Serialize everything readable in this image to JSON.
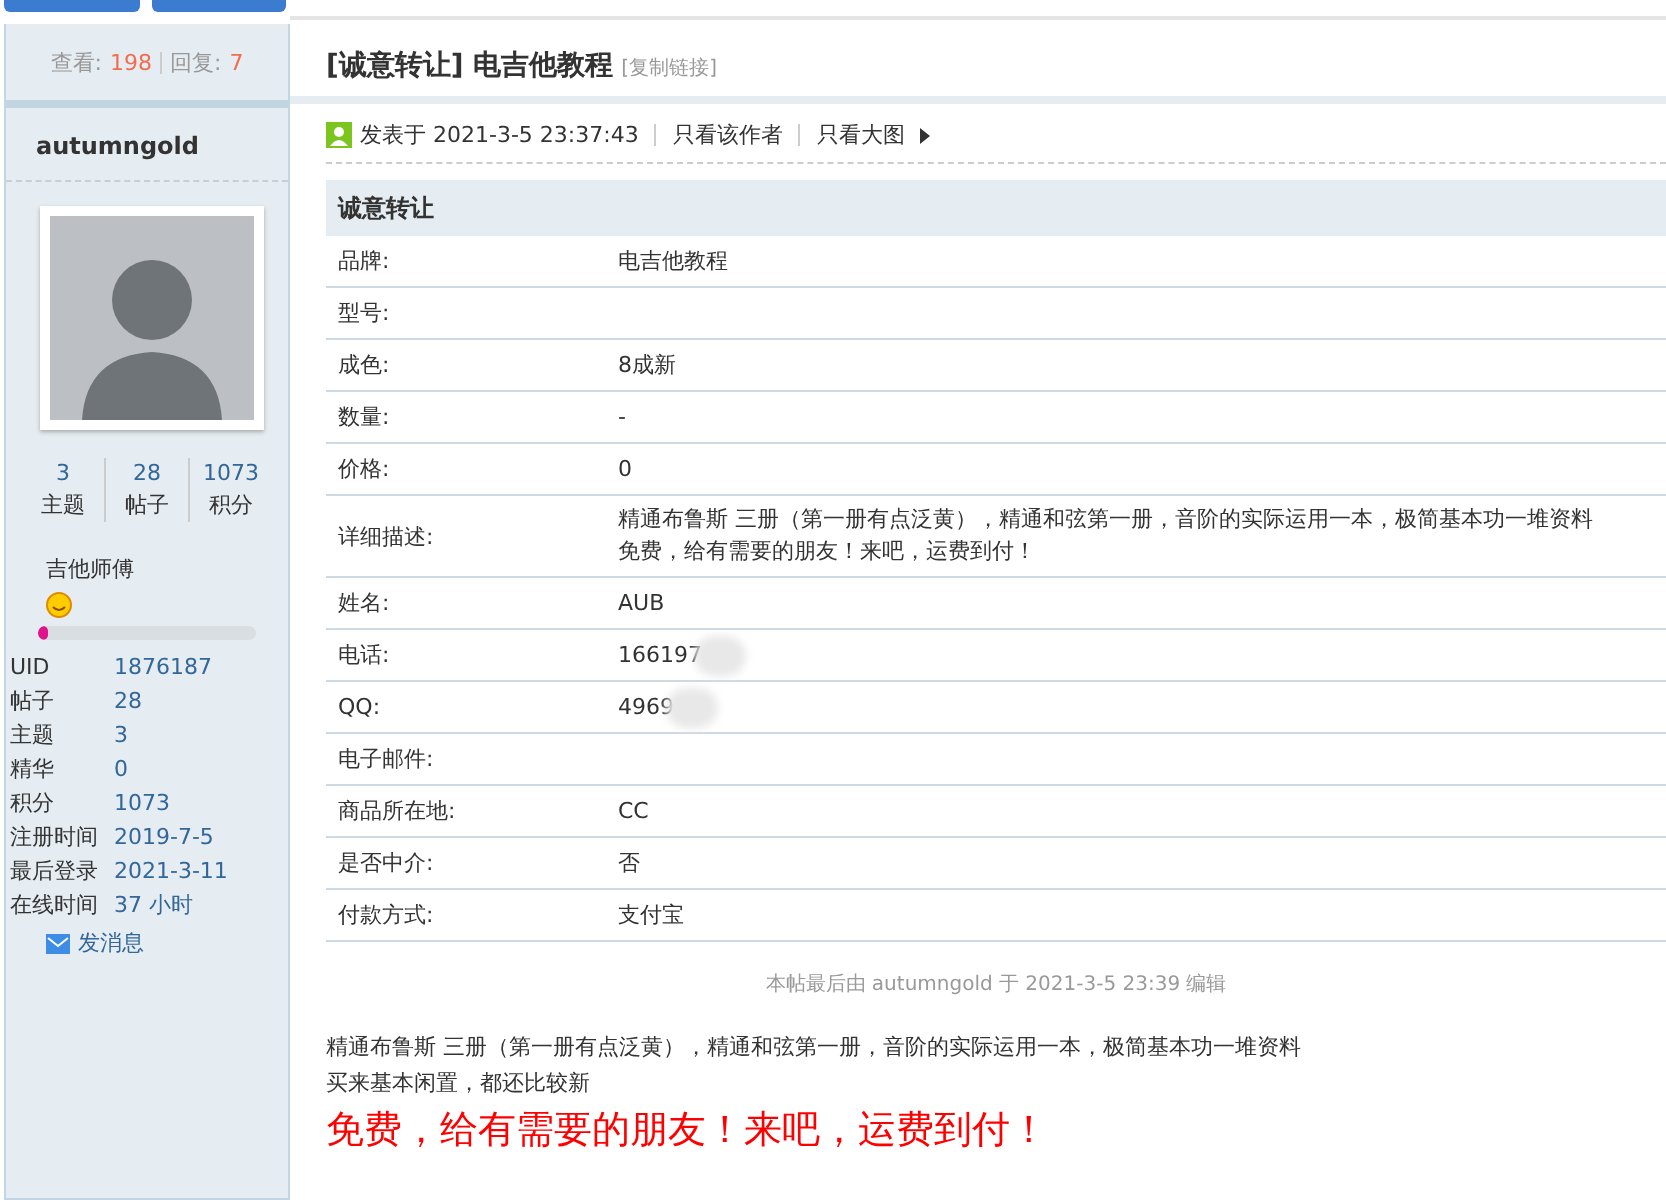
{
  "thread_stats": {
    "views_label": "查看:",
    "views": "198",
    "replies_label": "回复:",
    "replies": "7"
  },
  "author": {
    "name": "autumngold",
    "stats": [
      {
        "value": "3",
        "label": "主题"
      },
      {
        "value": "28",
        "label": "帖子"
      },
      {
        "value": "1073",
        "label": "积分"
      }
    ],
    "rank": "吉他师傅",
    "rank_progress": {
      "level": 0.05
    },
    "profile": [
      {
        "label": "UID",
        "value": "1876187"
      },
      {
        "label": "帖子",
        "value": "28"
      },
      {
        "label": "主题",
        "value": "3"
      },
      {
        "label": "精华",
        "value": "0"
      },
      {
        "label": "积分",
        "value": "1073"
      },
      {
        "label": "注册时间",
        "value": "2019-7-5"
      },
      {
        "label": "最后登录",
        "value": "2021-3-11"
      },
      {
        "label": "在线时间",
        "value": "37 小时"
      }
    ],
    "message_link": "发消息"
  },
  "post": {
    "title": "[诚意转让] 电吉他教程",
    "copy_link": "[复制链接]",
    "posted": "发表于 2021-3-5 23:37:43",
    "author_only": "只看该作者",
    "big_images": "只看大图",
    "table_title": "诚意转让",
    "fields": [
      {
        "label": "品牌:",
        "value": "电吉他教程"
      },
      {
        "label": "型号:"
      },
      {
        "label": "成色:",
        "value": "8成新"
      },
      {
        "label": "数量:",
        "value": "-"
      },
      {
        "label": "价格:",
        "value": "0"
      },
      {
        "label": "详细描述:",
        "lines": [
          "精通布鲁斯 三册（第一册有点泛黄），精通和弦第一册，音阶的实际运用一本，极简基本功一堆资料",
          "免费，给有需要的朋友！来吧，运费到付！"
        ]
      },
      {
        "label": "姓名:",
        "value": "AUB"
      },
      {
        "label": "电话:",
        "value": "166197",
        "blurred": true
      },
      {
        "label": "QQ:",
        "value": "4969",
        "blurred": true
      },
      {
        "label": "电子邮件:"
      },
      {
        "label": "商品所在地:",
        "value": "CC"
      },
      {
        "label": "是否中介:",
        "value": "否"
      },
      {
        "label": "付款方式:",
        "value": "支付宝"
      }
    ],
    "edit_note": "本帖最后由 autumngold 于 2021-3-5 23:39 编辑",
    "body": [
      "精通布鲁斯 三册（第一册有点泛黄），精通和弦第一册，音阶的实际运用一本，极简基本功一堆资料",
      "买来基本闲置，都还比较新"
    ],
    "highlight": "免费，给有需要的朋友！来吧，运费到付！"
  }
}
